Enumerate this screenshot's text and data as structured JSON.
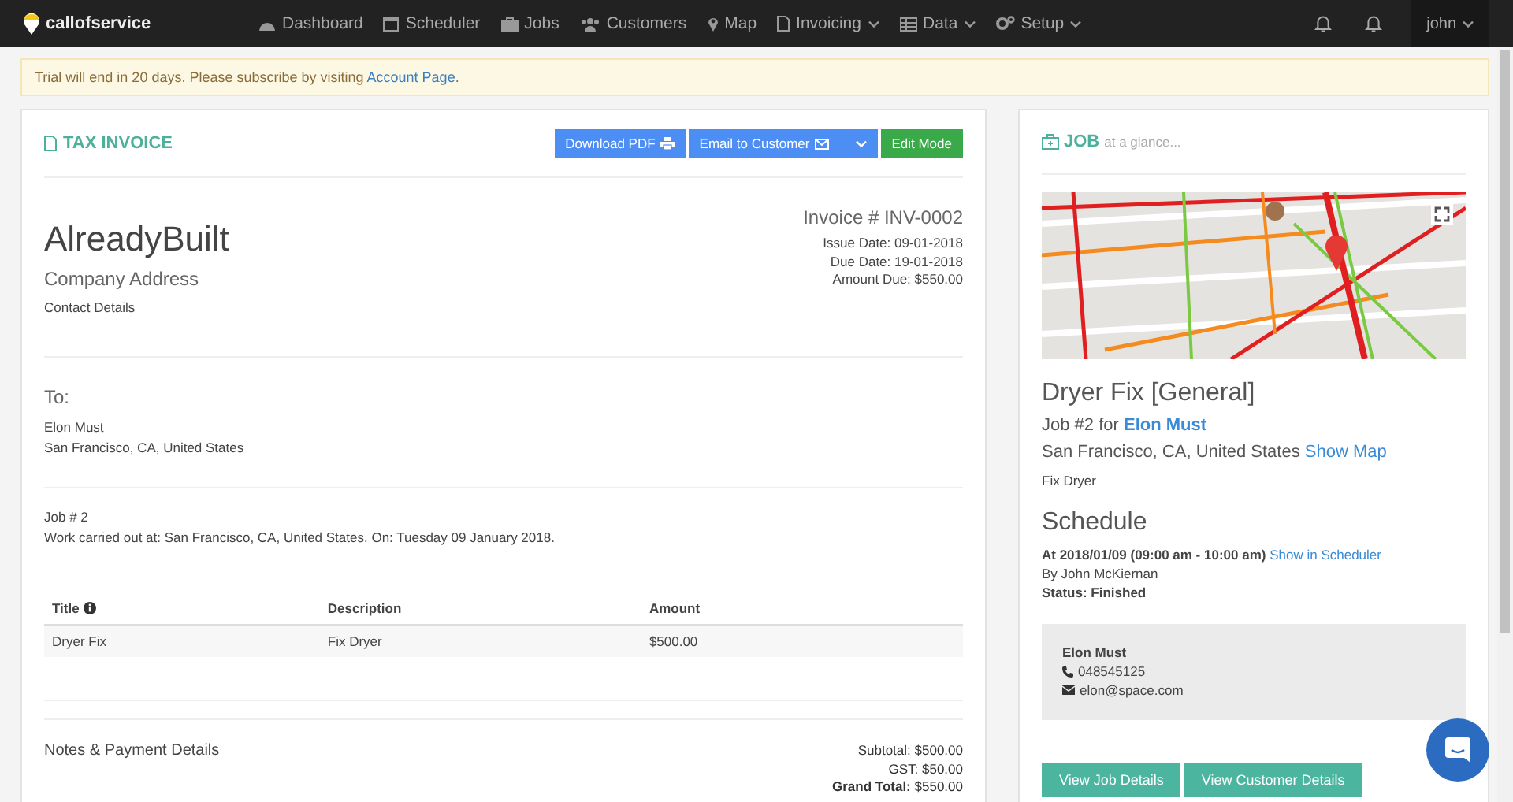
{
  "navbar": {
    "logo": "callofservice",
    "items": [
      {
        "label": "Dashboard",
        "has_caret": false
      },
      {
        "label": "Scheduler",
        "has_caret": false
      },
      {
        "label": "Jobs",
        "has_caret": false
      },
      {
        "label": "Customers",
        "has_caret": false
      },
      {
        "label": "Map",
        "has_caret": false
      },
      {
        "label": "Invoicing",
        "has_caret": true
      },
      {
        "label": "Data",
        "has_caret": true
      },
      {
        "label": "Setup",
        "has_caret": true
      }
    ],
    "user": "john"
  },
  "alert": {
    "text": "Trial will end in 20 days. Please subscribe by visiting",
    "link": "Account Page",
    "end": "."
  },
  "invoice": {
    "title": "TAX INVOICE",
    "buttons": [
      {
        "label": "Download PDF",
        "kind": "pdf"
      },
      {
        "label": "Email to Customer",
        "kind": "email"
      },
      {
        "label": "Edit Mode",
        "kind": "edit"
      }
    ],
    "company": {
      "name": "AlreadyBuilt",
      "address": "Company Address",
      "contact": "Contact Details"
    },
    "meta": {
      "number": "Invoice # INV-0002",
      "lines": [
        "Issue Date: 09-01-2018",
        "Due Date: 19-01-2018",
        "Amount Due: $550.00"
      ]
    },
    "to": {
      "label": "To:",
      "name": "Elon Must",
      "address": "San Francisco, CA, United States"
    },
    "job": {
      "number": "Job # 2",
      "work": "Work carried out at: San Francisco, CA, United States. On: Tuesday 09 January 2018."
    },
    "table": {
      "columns": [
        "Title",
        "Description",
        "Amount"
      ],
      "rows": [
        {
          "title": "Dryer Fix",
          "description": "Fix Dryer",
          "amount": "$500.00"
        }
      ]
    },
    "notes_label": "Notes & Payment Details",
    "totals": [
      {
        "label": "Subtotal:",
        "value": "$500.00",
        "bold": false
      },
      {
        "label": "GST:",
        "value": "$50.00",
        "bold": false
      },
      {
        "label": "Grand Total:",
        "value": "$550.00",
        "bold": true
      }
    ]
  },
  "job_panel": {
    "heading": "JOB",
    "subheading": "at a glance...",
    "map": {
      "kind": "picture"
    },
    "title": "Dryer Fix [General]",
    "job_for": "Job #2 for",
    "customer": "Elon Must",
    "address": "San Francisco, CA, United States",
    "show_map": "Show Map",
    "description": "Fix Dryer",
    "schedule_heading": "Schedule",
    "when": "At 2018/01/09 (09:00 am - 10:00 am)",
    "show_in_scheduler": "Show in Scheduler",
    "by": "By John McKiernan",
    "status": "Status: Finished",
    "contact": {
      "name": "Elon Must",
      "phone": "048545125",
      "email": "elon@space.com"
    },
    "buttons": [
      "View Job Details",
      "View Customer Details"
    ]
  }
}
